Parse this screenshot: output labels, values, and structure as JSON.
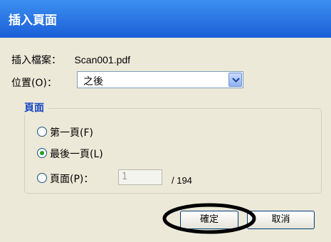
{
  "window": {
    "title": "插入頁面"
  },
  "file": {
    "label": "插入檔案：",
    "name": "Scan001.pdf"
  },
  "position": {
    "label": "位置(O)：",
    "selected": "之後"
  },
  "group": {
    "title": "頁面",
    "options": [
      {
        "label": "第一頁(F)",
        "selected": false
      },
      {
        "label": "最後一頁(L)",
        "selected": true
      },
      {
        "label": "頁面(P)：",
        "selected": false
      }
    ],
    "page_input_value": "1",
    "page_total": "/ 194"
  },
  "buttons": {
    "ok": "確定",
    "cancel": "取消"
  },
  "colors": {
    "title_bar": "#2a6fe2",
    "group_title": "#1646c4",
    "selected_radio": "#21a121"
  }
}
